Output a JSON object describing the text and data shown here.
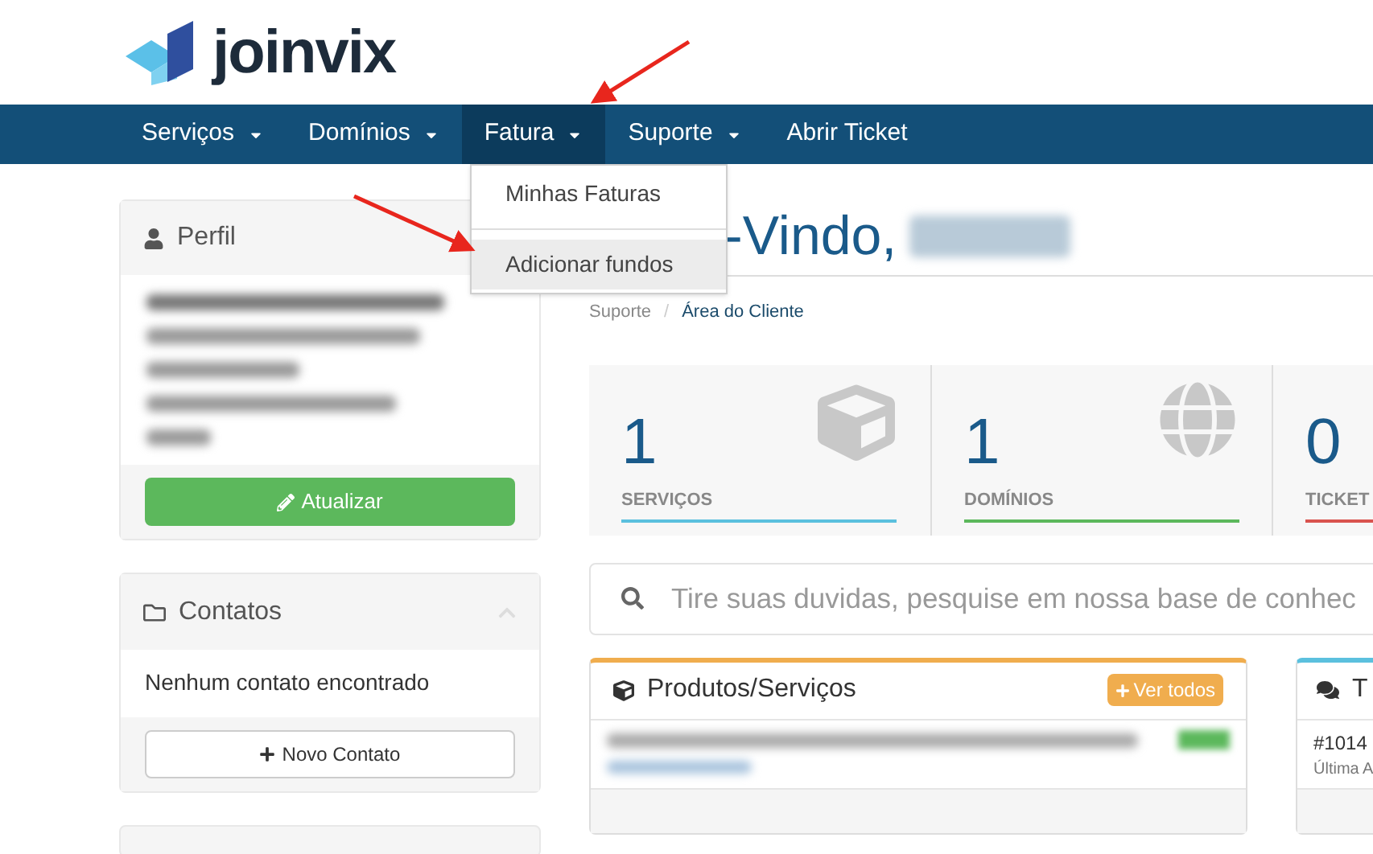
{
  "logo": {
    "text": "joinvix"
  },
  "nav": [
    {
      "label": "Serviços",
      "dropdown": true,
      "selected": false
    },
    {
      "label": "Domínios",
      "dropdown": true,
      "selected": false
    },
    {
      "label": "Fatura",
      "dropdown": true,
      "selected": true
    },
    {
      "label": "Suporte",
      "dropdown": true,
      "selected": false
    },
    {
      "label": "Abrir Ticket",
      "dropdown": false,
      "selected": false
    }
  ],
  "dropdown_menu": [
    {
      "label": "Minhas Faturas",
      "selected": false
    },
    {
      "label": "Adicionar fundos",
      "selected": true
    }
  ],
  "sidebar": {
    "profile": {
      "title": "Perfil",
      "button": "Atualizar"
    },
    "contacts": {
      "title": "Contatos",
      "expanded": true,
      "empty_text": "Nenhum contato encontrado",
      "button": "Novo Contato"
    }
  },
  "main": {
    "heading": "-Vindo,",
    "breadcrumb_separator": "/",
    "breadcrumb": [
      {
        "label": "Suporte",
        "selected": false
      },
      {
        "label": "Área do Cliente",
        "selected": true
      }
    ],
    "stats": [
      {
        "value": "1",
        "label": "SERVIÇOS",
        "color": "#5bc0de",
        "kind": "box"
      },
      {
        "value": "1",
        "label": "DOMÍNIOS",
        "color": "#5cb85c",
        "kind": "globe"
      },
      {
        "value": "0",
        "label": "TICKET",
        "color": "#d9534f",
        "kind": "none"
      }
    ],
    "search": {
      "placeholder": "Tire suas duvidas, pesquise em nossa base de conhec"
    },
    "panels": [
      {
        "kind": "products",
        "title": "Produtos/Serviços",
        "color": "#f0ad4e",
        "button": "Ver todos"
      },
      {
        "kind": "tickets",
        "title": "T",
        "color": "#5bc0de",
        "rows": [
          {
            "text": "#1014",
            "sub": "Última A"
          }
        ]
      }
    ]
  }
}
